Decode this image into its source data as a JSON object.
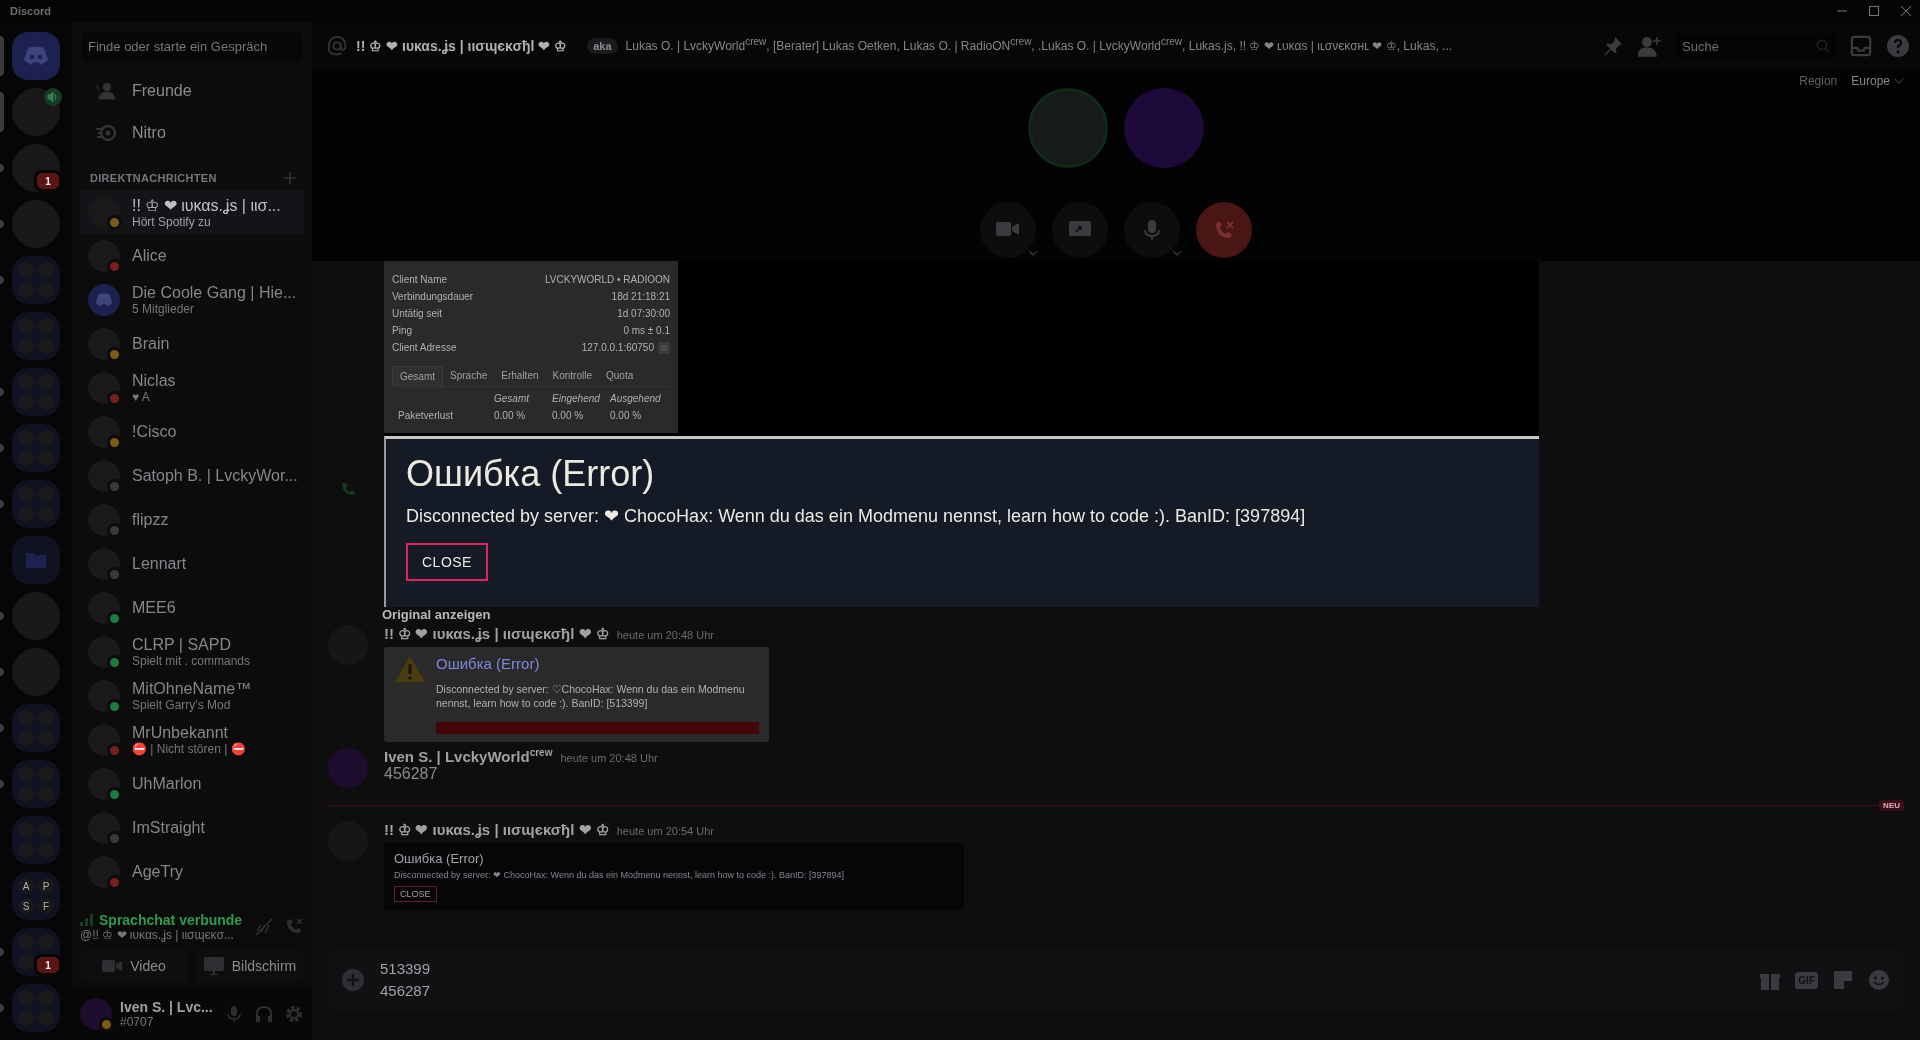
{
  "window": {
    "title": "Discord"
  },
  "servers": [
    {
      "kind": "home",
      "selected": true,
      "unread": false
    },
    {
      "kind": "avatar",
      "selected": true,
      "unread": false,
      "voice": true
    },
    {
      "kind": "avatar",
      "selected": false,
      "unread": true,
      "badge": "1"
    },
    {
      "kind": "avatar",
      "selected": false,
      "unread": true
    },
    {
      "kind": "folder",
      "selected": false,
      "unread": true
    },
    {
      "kind": "folder",
      "selected": false,
      "unread": false
    },
    {
      "kind": "folder",
      "selected": false,
      "unread": true
    },
    {
      "kind": "folder",
      "selected": false,
      "unread": true
    },
    {
      "kind": "folder",
      "selected": false,
      "unread": true
    },
    {
      "kind": "folder-open",
      "selected": false,
      "unread": false
    },
    {
      "kind": "avatar",
      "selected": false,
      "unread": true
    },
    {
      "kind": "avatar",
      "selected": false,
      "unread": true
    },
    {
      "kind": "folder",
      "selected": false,
      "unread": true
    },
    {
      "kind": "folder",
      "selected": false,
      "unread": true
    },
    {
      "kind": "folder",
      "selected": false,
      "unread": false
    },
    {
      "kind": "folder",
      "selected": false,
      "unread": false,
      "letters": [
        "A",
        "P",
        "S",
        "F"
      ]
    },
    {
      "kind": "folder",
      "selected": false,
      "unread": true,
      "badge": "1"
    },
    {
      "kind": "folder",
      "selected": false,
      "unread": true
    }
  ],
  "sidebar": {
    "search": {
      "placeholder": "Finde oder starte ein Gespräch"
    },
    "nav": [
      {
        "label": "Freunde",
        "kind": "friends"
      },
      {
        "label": "Nitro",
        "kind": "nitro"
      }
    ],
    "section": "DIREKTNACHRICHTEN",
    "dms": [
      {
        "name": "!! ♔ ❤ ιυκαѕ.ʝѕ | ιισ...",
        "sub": "Hört Spotify zu",
        "color": "#7a5c14",
        "kind": "user",
        "selected": true
      },
      {
        "name": "Alice",
        "color": "#7a1e1e",
        "kind": "user",
        "selected": false
      },
      {
        "name": "Die Coole Gang | Hie...",
        "sub": "5 Mitglieder",
        "kind": "group",
        "selected": false
      },
      {
        "name": "Brain",
        "color": "#7a5c14",
        "kind": "user",
        "selected": false
      },
      {
        "name": "Niclas",
        "sub": "♥ A",
        "color": "#7a1e1e",
        "kind": "user",
        "selected": false
      },
      {
        "name": "!Cisco",
        "color": "#7a5c14",
        "kind": "user",
        "selected": false
      },
      {
        "name": "Satoph B. | LvckyWor...",
        "color": "#3a3b3f",
        "kind": "user",
        "selected": false
      },
      {
        "name": "flipzz",
        "color": "#3a3b3f",
        "kind": "user",
        "selected": false
      },
      {
        "name": "Lennart",
        "color": "#3a3b3f",
        "kind": "user",
        "selected": false
      },
      {
        "name": "MEE6",
        "color": "#1f7a3f",
        "kind": "user",
        "selected": false
      },
      {
        "name": "CLRP | SAPD",
        "sub": "Spielt mit . commands",
        "color": "#1f7a3f",
        "kind": "user",
        "selected": false
      },
      {
        "name": "MitOhneName™",
        "sub": "Spielt Garry's Mod",
        "color": "#1f7a3f",
        "kind": "user",
        "selected": false
      },
      {
        "name": "MrUnbekannt",
        "sub": "⛔ | Nicht stören | ⛔",
        "color": "#7a1e1e",
        "kind": "user",
        "selected": false
      },
      {
        "name": "UhMarlon",
        "color": "#1f7a3f",
        "kind": "user",
        "selected": false
      },
      {
        "name": "ImStraight",
        "color": "#3a3b3f",
        "kind": "user",
        "selected": false
      },
      {
        "name": "AgeTry",
        "color": "#7a1e1e",
        "kind": "user",
        "selected": false
      }
    ],
    "voice": {
      "status": "Sprachchat verbunde",
      "channel": "@!! ♔ ❤ ιυκαѕ.ʝѕ | ιισɰєκσ..."
    },
    "media_buttons": [
      "Video",
      "Bildschirm"
    ],
    "user": {
      "name": "Iven S. | Lvc...",
      "tag": "#0707",
      "color": "#7a5c14"
    }
  },
  "header": {
    "name": "!! ♔ ❤ ιυκαѕ.ʝѕ | ιισɰєκσђl ❤ ♔",
    "aka": "aka",
    "aliases": "Lukas O. | LvckyWorld$^{crew}$, [Berater] Lukas Oetken, Lukas O. | RadioON$^{crew}$, .Lukas O. | LvckyWorld$^{crew}$, Lukas.js, !! ♔ ❤ ʟᴜᴋαѕ | ιʟσνєκσнʟ ❤ ♔, Lukas, ...",
    "search": {
      "placeholder": "Suche"
    }
  },
  "call": {
    "region_label": "Region",
    "region": "Europe",
    "participants": [
      {
        "kind": "photo"
      },
      {
        "kind": "logo"
      }
    ],
    "controls": [
      {
        "kind": "camera"
      },
      {
        "kind": "screen"
      },
      {
        "kind": "mic"
      },
      {
        "kind": "hangup"
      }
    ]
  },
  "viewer": {
    "panel": {
      "rows": [
        {
          "label": "Client Name",
          "value": "LVCKYWORLD • RADIOON"
        },
        {
          "label": "Verbindungsdauer",
          "value": "18d 21:18:21"
        },
        {
          "label": "Untätig seit",
          "value": "1d 07:30:00"
        },
        {
          "label": "Ping",
          "value": "0 ms ± 0.1"
        },
        {
          "label": "Client Adresse",
          "value": "127.0.0.1:60750"
        }
      ],
      "tabs": [
        {
          "label": "Gesamt",
          "selected": true
        },
        {
          "label": "Sprache",
          "selected": false
        },
        {
          "label": "Erhalten",
          "selected": false
        },
        {
          "label": "Kontrolle",
          "selected": false
        },
        {
          "label": "Quota",
          "selected": false
        }
      ],
      "columns": [
        "Gesamt",
        "Eingehend",
        "Ausgehend"
      ],
      "row": {
        "label": "Paketverlust",
        "values": [
          "0.00 %",
          "0.00 %",
          "0.00 %"
        ]
      }
    },
    "dialog": {
      "title": "Ошибка (Error)",
      "text": "Disconnected by server: ❤ ChocoHax: Wenn du das ein Modmenu nennst, learn how to code :). BanID: [397894]",
      "button": "CLOSE"
    },
    "link": "Original anzeigen"
  },
  "messages": [
    {
      "kind": "warning-embed",
      "author": "!! ♔ ❤ ιυκαѕ.ʝѕ | ιισɰєκσђl ❤ ♔",
      "time": "heute um 20:48 Uhr",
      "title": "Ошибка (Error)",
      "text": "Disconnected by server: ♡ChocoHax: Wenn du das ein Modmenu nennst, learn how to code :). BanID: [513399]"
    },
    {
      "kind": "text",
      "author": "Iven S. | LvckyWorld$^{crew}$",
      "time": "heute um 20:48 Uhr",
      "text": "456287"
    },
    {
      "kind": "divider",
      "label": "NEU"
    },
    {
      "kind": "image-embed",
      "author": "!! ♔ ❤ ιυκαѕ.ʝѕ | ιισɰєκσђl ❤ ♔",
      "time": "heute um 20:54 Uhr",
      "title": "Ошибка (Error)",
      "text": "Disconnected by server: ❤ ChocoHax: Wenn du das ein Modmenu nennst, learn how to code :). BanID: [397894]",
      "button": "CLOSE"
    }
  ],
  "composer": {
    "value": "513399\n456287",
    "gif": "GIF"
  }
}
